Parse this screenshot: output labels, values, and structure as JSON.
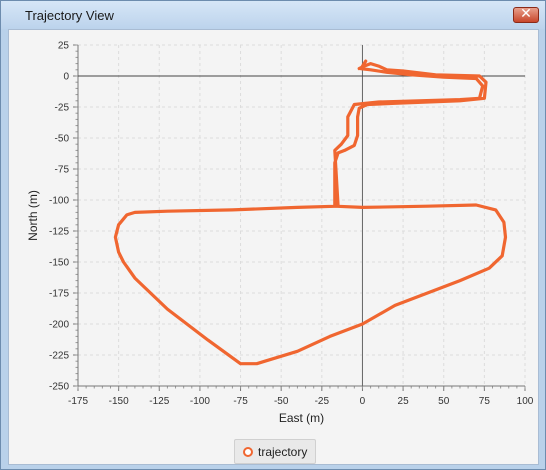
{
  "window": {
    "title": "Trajectory View",
    "close_label": "✕"
  },
  "chart_data": {
    "type": "line",
    "title": "",
    "xlabel": "East (m)",
    "ylabel": "North (m)",
    "xlim": [
      -175,
      100
    ],
    "ylim": [
      -250,
      25
    ],
    "xticks": [
      -175,
      -150,
      -125,
      -100,
      -75,
      -50,
      -25,
      0,
      25,
      50,
      75,
      100
    ],
    "yticks": [
      25,
      0,
      -25,
      -50,
      -75,
      -100,
      -125,
      -150,
      -175,
      -200,
      -225,
      -250
    ],
    "grid": true,
    "legend": "bottom-center",
    "series": [
      {
        "name": "trajectory",
        "color": "#f06630",
        "points": [
          [
            -2,
            6
          ],
          [
            1,
            8
          ],
          [
            5,
            10
          ],
          [
            10,
            8
          ],
          [
            15,
            5
          ],
          [
            25,
            4
          ],
          [
            45,
            1
          ],
          [
            72,
            0
          ],
          [
            76,
            -5
          ],
          [
            75,
            -18
          ],
          [
            60,
            -20
          ],
          [
            40,
            -21
          ],
          [
            20,
            -22
          ],
          [
            3,
            -23
          ],
          [
            -2,
            -26
          ],
          [
            -3,
            -33
          ],
          [
            -3,
            -48
          ],
          [
            -5,
            -56
          ],
          [
            -11,
            -60
          ],
          [
            -15,
            -62
          ],
          [
            -17,
            -70
          ],
          [
            -17,
            -105
          ],
          [
            0,
            -106
          ],
          [
            40,
            -105
          ],
          [
            70,
            -104
          ],
          [
            82,
            -108
          ],
          [
            87,
            -118
          ],
          [
            88,
            -130
          ],
          [
            86,
            -145
          ],
          [
            78,
            -155
          ],
          [
            60,
            -165
          ],
          [
            40,
            -175
          ],
          [
            20,
            -185
          ],
          [
            0,
            -200
          ],
          [
            -20,
            -210
          ],
          [
            -40,
            -222
          ],
          [
            -60,
            -230
          ],
          [
            -65,
            -232
          ],
          [
            -75,
            -232
          ],
          [
            -95,
            -213
          ],
          [
            -120,
            -188
          ],
          [
            -140,
            -163
          ],
          [
            -147,
            -150
          ],
          [
            -150,
            -142
          ],
          [
            -152,
            -130
          ],
          [
            -150,
            -120
          ],
          [
            -145,
            -112
          ],
          [
            -140,
            -110
          ],
          [
            -120,
            -109
          ],
          [
            -80,
            -108
          ],
          [
            -40,
            -106
          ],
          [
            -15,
            -105
          ],
          [
            -17,
            -60
          ],
          [
            -13,
            -55
          ],
          [
            -9,
            -48
          ],
          [
            -9,
            -33
          ],
          [
            -5,
            -23
          ],
          [
            10,
            -21
          ],
          [
            60,
            -19
          ],
          [
            72,
            -18
          ],
          [
            74,
            -8
          ],
          [
            70,
            -2
          ],
          [
            50,
            -1
          ],
          [
            30,
            1
          ],
          [
            15,
            3
          ],
          [
            5,
            5
          ],
          [
            -1,
            6
          ],
          [
            0,
            8
          ],
          [
            2,
            12
          ]
        ]
      }
    ]
  }
}
